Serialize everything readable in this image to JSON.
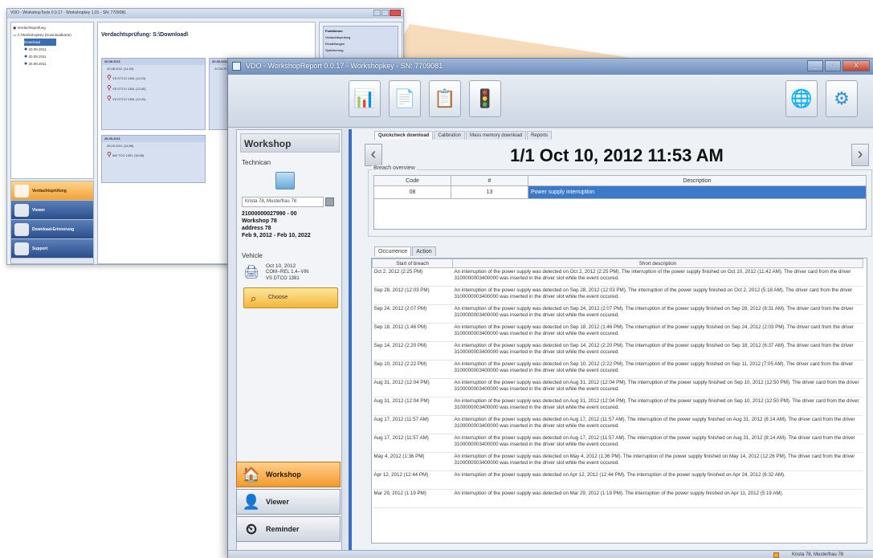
{
  "background_window": {
    "title": "VDO - WorkshopTools 0.0.17 - Workshopkey 1.01 - SN: 7709081",
    "tree": [
      "Verdachtsprüfung",
      "C:\\Workshopkey (Downloadkarte)",
      "Download",
      "20.08.2011",
      "20.09.2011",
      "26.09.2011"
    ],
    "heading": "Verdachtsprüfung: S:\\Download\\",
    "cards": [
      {
        "title": "20.08.2011",
        "rows": [
          "20.08.2011 (14:33)",
          "VS DTCO 1381 (11:03)",
          "VS DTCO 1381 (12:40)",
          "VS DTCO 1381 (12:43)"
        ]
      },
      {
        "title": "20.09.2011",
        "rows": [
          "20.09.2011"
        ]
      },
      {
        "title": "26.09.2011",
        "rows": [
          "26.09.2011 (18:58)",
          "AW TCO 1381 (18:58)"
        ]
      }
    ],
    "nav": [
      {
        "label": "Verdachtsprüfung",
        "active": true
      },
      {
        "label": "Viewer",
        "active": false
      },
      {
        "label": "Download-Erinnerung",
        "active": false
      },
      {
        "label": "Support",
        "active": false
      }
    ],
    "right_panel": {
      "title": "Funktionen",
      "items": [
        "Verdachtsprüfung",
        "Einstellungen",
        "Speicherung"
      ]
    }
  },
  "window": {
    "title": "VDO - WorkshopReport 0.0.17 - Workshopkey - SN: 7709081",
    "controls": [
      "_",
      "□",
      "X"
    ]
  },
  "toolbar": {
    "buttons": [
      {
        "name": "download-card-icon",
        "glyph": "📊"
      },
      {
        "name": "copy-document-icon",
        "glyph": "📄"
      },
      {
        "name": "print-document-icon",
        "glyph": "📋"
      },
      {
        "name": "traffic-light-icon",
        "glyph": "🚦"
      }
    ],
    "right_buttons": [
      {
        "name": "globe-icon",
        "glyph": "🌐"
      },
      {
        "name": "settings-icon",
        "glyph": "⚙"
      }
    ]
  },
  "workshop_panel": {
    "title": "Workshop",
    "technician_label": "Technican",
    "technician_selected": "Krista 78, Musterfrau 78",
    "card_number": "21000000027990 - 00",
    "workshop_name": "Workshop 78",
    "address": "address 78",
    "validity": "Feb 9, 2012 - Feb 10, 2022",
    "vehicle_label": "Vehicle",
    "vehicle_date": "Oct 10, 2012",
    "vehicle_vin": "COM--REL 1.4--VIN",
    "vehicle_device": "VS DTCO 1381",
    "choose_label": "Choose"
  },
  "nav": [
    {
      "label": "Workshop",
      "active": true,
      "icon": "workshop-icon",
      "glyph": "🏠"
    },
    {
      "label": "Viewer",
      "active": false,
      "icon": "viewer-icon",
      "glyph": "👤"
    },
    {
      "label": "Reminder",
      "active": false,
      "icon": "reminder-icon",
      "glyph": "⏲"
    }
  ],
  "tabs": [
    {
      "label": "Quickcheck download",
      "active": true
    },
    {
      "label": "Calibration",
      "active": false
    },
    {
      "label": "Mass memory download",
      "active": false
    },
    {
      "label": "Reports",
      "active": false
    }
  ],
  "report": {
    "title": "1/1 Oct 10, 2012 11:53 AM",
    "prev": "‹",
    "next": "›"
  },
  "breach_overview": {
    "label": "Breach overview",
    "columns": [
      "Code",
      "#",
      "Description"
    ],
    "rows": [
      {
        "code": "08",
        "count": "13",
        "description": "Power supply interruption"
      }
    ]
  },
  "occurrence": {
    "tabs": [
      {
        "label": "Occurrence",
        "active": true
      },
      {
        "label": "Action",
        "active": false
      }
    ],
    "columns": [
      "Start of breach",
      "Short description"
    ],
    "rows": [
      {
        "start": "Oct 2, 2012 (2:25 PM)",
        "desc": "An interruption of the power supply was detected on Oct 2, 2012 (2:25 PM). The interruption of the power supply finished on Oct 10, 2012 (11:42 AM). The driver card from the driver 3100000003400000 was inserted in the driver slot while the event occured."
      },
      {
        "start": "Sep 28, 2012 (12:03 PM)",
        "desc": "An interruption of the power supply was detected on Sep 28, 2012 (12:03 PM). The interruption of the power supply finished on Oct 2, 2012 (5:18 AM). The driver card from the driver 3100000003400000 was inserted in the driver slot while the event occured."
      },
      {
        "start": "Sep 24, 2012 (2:07 PM)",
        "desc": "An interruption of the power supply was detected on Sep 24, 2012 (2:07 PM). The interruption of the power supply finished on Sep 28, 2012 (8:31 AM). The driver card from the driver 3100000003400000 was inserted in the driver slot while the event occured."
      },
      {
        "start": "Sep 18, 2012 (1:46 PM)",
        "desc": "An interruption of the power supply was detected on Sep 18, 2012 (1:46 PM). The interruption of the power supply finished on Sep 24, 2012 (2:03 PM). The driver card from the driver 3100000003400000 was inserted in the driver slot while the event occured."
      },
      {
        "start": "Sep 14, 2012 (2:20 PM)",
        "desc": "An interruption of the power supply was detected on Sep 14, 2012 (2:20 PM). The interruption of the power supply finished on Sep 18, 2012 (6:37 AM). The driver card from the driver 3100000003400000 was inserted in the driver slot while the event occured."
      },
      {
        "start": "Sep 10, 2012 (2:22 PM)",
        "desc": "An interruption of the power supply was detected on Sep 10, 2012 (2:22 PM). The interruption of the power supply finished on Sep 11, 2012 (7:05 AM). The driver card from the driver 3100000003400000 was inserted in the driver slot while the event occured."
      },
      {
        "start": "Aug 31, 2012 (12:04 PM)",
        "desc": "An interruption of the power supply was detected on Aug 31, 2012 (12:04 PM). The interruption of the power supply finished on Sep 10, 2012 (12:50 PM). The driver card from the driver 3100000003400000 was inserted in the driver slot while the event occured."
      },
      {
        "start": "Aug 31, 2012 (12:04 PM)",
        "desc": "An interruption of the power supply was detected on Aug 31, 2012 (12:04 PM). The interruption of the power supply finished on Sep 10, 2012 (12:50 PM). The driver card from the driver 3100000003400000 was inserted in the driver slot while the event occured."
      },
      {
        "start": "Aug 17, 2012 (11:57 AM)",
        "desc": "An interruption of the power supply was detected on Aug 17, 2012 (11:57 AM). The interruption of the power supply finished on Aug 31, 2012 (8:14 AM). The driver card from the driver 3100000003400000 was inserted in the driver slot while the event occured."
      },
      {
        "start": "Aug 17, 2012 (11:57 AM)",
        "desc": "An interruption of the power supply was detected on Aug 17, 2012 (11:57 AM). The interruption of the power supply finished on Aug 31, 2012 (8:14 AM). The driver card from the driver 3100000003400000 was inserted in the driver slot while the event occured."
      },
      {
        "start": "May 4, 2012 (1:36 PM)",
        "desc": "An interruption of the power supply was detected on May 4, 2012 (1:36 PM). The interruption of the power supply finished on May 14, 2012 (12:26 PM). The driver card from the driver 3100000003400000 was inserted in the driver slot while the event occured."
      },
      {
        "start": "Apr 12, 2012 (12:44 PM)",
        "desc": "An interruption of the power supply was detected on Apr 12, 2012 (12:44 PM). The interruption of the power supply finished on Apr 24, 2012 (6:32 AM)."
      },
      {
        "start": "Mar 29, 2012 (1:19 PM)",
        "desc": "An interruption of the power supply was detected on Mar 29, 2012 (1:19 PM). The interruption of the power supply finished on Apr 11, 2012 (5:19 AM)."
      }
    ]
  },
  "statusbar": {
    "user": "Krista 78, Musterfrau 78"
  },
  "colors": {
    "accent": "#3c6fc1",
    "active_nav": "#f29a2e",
    "zoom_shape": "#f7d9b3"
  }
}
